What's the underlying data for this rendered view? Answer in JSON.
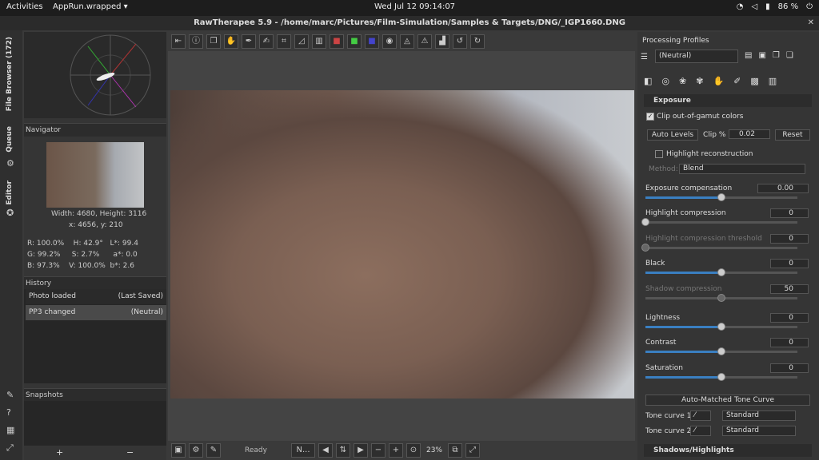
{
  "topbar": {
    "activities": "Activities",
    "app": "AppRun.wrapped ▾",
    "clock": "Wed Jul 12  09:14:07",
    "battery": "86 %"
  },
  "window_title": "RawTherapee 5.9 - /home/marc/Pictures/Film-Simulation/Samples & Targets/DNG/_IGP1660.DNG",
  "vtabs": {
    "file_browser": "File Browser (172)",
    "queue": "Queue",
    "editor": "Editor"
  },
  "navigator": {
    "title": "Navigator",
    "size": "Width: 4680, Height: 3116",
    "coords": "x: 4656, y: 210",
    "r": "R:",
    "rv": "100.0%",
    "h": "H:",
    "hv": "42.9°",
    "l": "L*:",
    "lv": "99.4",
    "g": "G:",
    "gv": "99.2%",
    "s": "S:",
    "sv": "2.7%",
    "a": "a*:",
    "av": "0.0",
    "b": "B:",
    "bv": "97.3%",
    "v": "V:",
    "vv": "100.0%",
    "bs": "b*:",
    "bsv": "2.6"
  },
  "history": {
    "title": "History",
    "rows": [
      {
        "a": "Photo loaded",
        "b": "(Last Saved)"
      },
      {
        "a": "PP3 changed",
        "b": "(Neutral)"
      }
    ]
  },
  "snapshots": {
    "title": "Snapshots",
    "add": "+",
    "remove": "−"
  },
  "status": {
    "ready": "Ready",
    "zoom": "23%",
    "n": "N..."
  },
  "profiles": {
    "title": "Processing Profiles",
    "value": "(Neutral)"
  },
  "exposure": {
    "title": "Exposure",
    "clip_label": "Clip out-of-gamut colors",
    "auto_levels": "Auto Levels",
    "clip_pct": "Clip %",
    "clip_val": "0.02",
    "reset": "Reset",
    "hl_recon": "Highlight reconstruction",
    "method": "Method:",
    "method_val": "Blend",
    "sliders": [
      {
        "label": "Exposure compensation",
        "value": "0.00",
        "pos": 0.5
      },
      {
        "label": "Highlight compression",
        "value": "0",
        "pos": 0.0
      },
      {
        "label": "Highlight compression threshold",
        "value": "0",
        "pos": 0.0
      },
      {
        "label": "Black",
        "value": "0",
        "pos": 0.5
      },
      {
        "label": "Shadow compression",
        "value": "50",
        "pos": 0.5
      },
      {
        "label": "Lightness",
        "value": "0",
        "pos": 0.5
      },
      {
        "label": "Contrast",
        "value": "0",
        "pos": 0.5
      },
      {
        "label": "Saturation",
        "value": "0",
        "pos": 0.5
      }
    ],
    "auto_tone": "Auto-Matched Tone Curve",
    "tc1": "Tone curve 1:",
    "tc2": "Tone curve 2:",
    "tc_val": "Standard"
  },
  "shadows": "Shadows/Highlights"
}
